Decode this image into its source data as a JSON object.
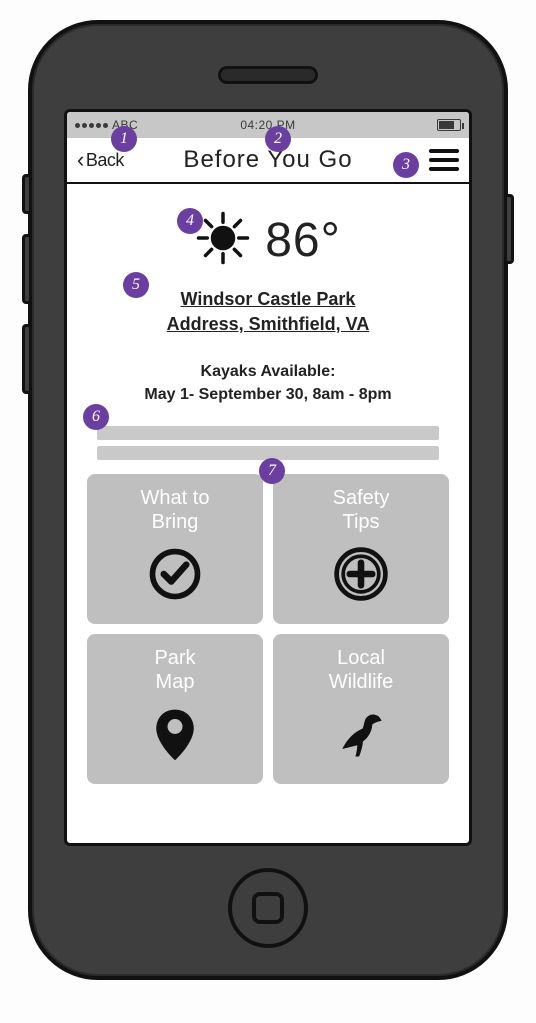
{
  "status_bar": {
    "carrier": "ABC",
    "time": "04:20 PM"
  },
  "nav": {
    "back_label": "Back",
    "title": "Before You Go"
  },
  "weather": {
    "temperature_display": "86°"
  },
  "location": {
    "name": "Windsor Castle Park",
    "address_line": "Address, Smithfield, VA"
  },
  "availability": {
    "heading": "Kayaks Available:",
    "detail": "May 1- September 30, 8am - 8pm"
  },
  "cards": {
    "what_to_bring": "What to\nBring",
    "safety_tips": "Safety\nTips",
    "park_map": "Park\nMap",
    "local_wildlife": "Local\nWildlife"
  },
  "annotations": {
    "a1": "1",
    "a2": "2",
    "a3": "3",
    "a4": "4",
    "a5": "5",
    "a6": "6",
    "a7": "7"
  }
}
